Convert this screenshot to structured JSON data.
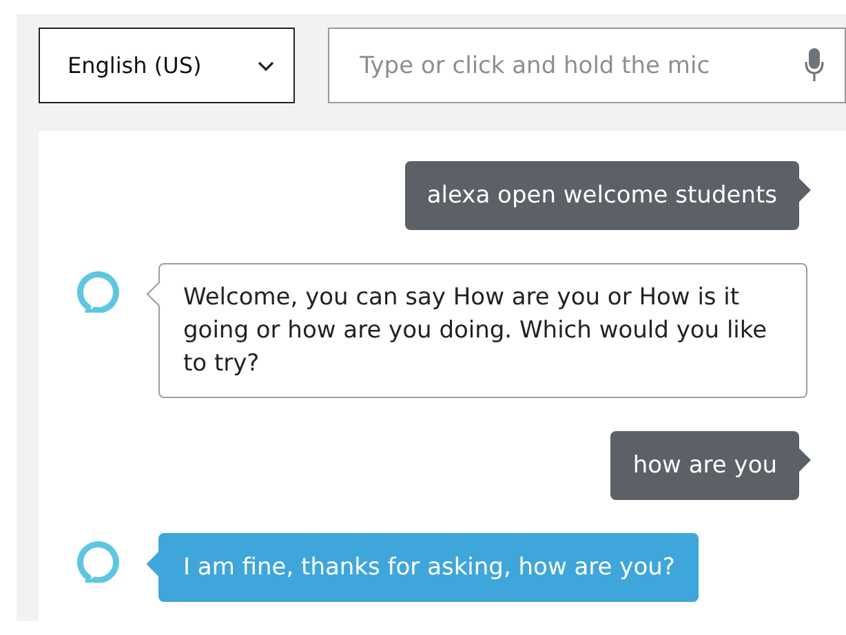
{
  "language_select": {
    "value": "English (US)"
  },
  "input": {
    "placeholder": "Type or click and hold the mic"
  },
  "messages": [
    {
      "kind": "user",
      "text": "alexa open welcome students"
    },
    {
      "kind": "alexa",
      "highlighted": false,
      "text": "Welcome, you can say How are you or How is it going or how are you doing. Which would you like to try?"
    },
    {
      "kind": "user",
      "text": "how are you"
    },
    {
      "kind": "alexa",
      "highlighted": true,
      "text": "I am fine, thanks for asking, how are you?"
    }
  ]
}
